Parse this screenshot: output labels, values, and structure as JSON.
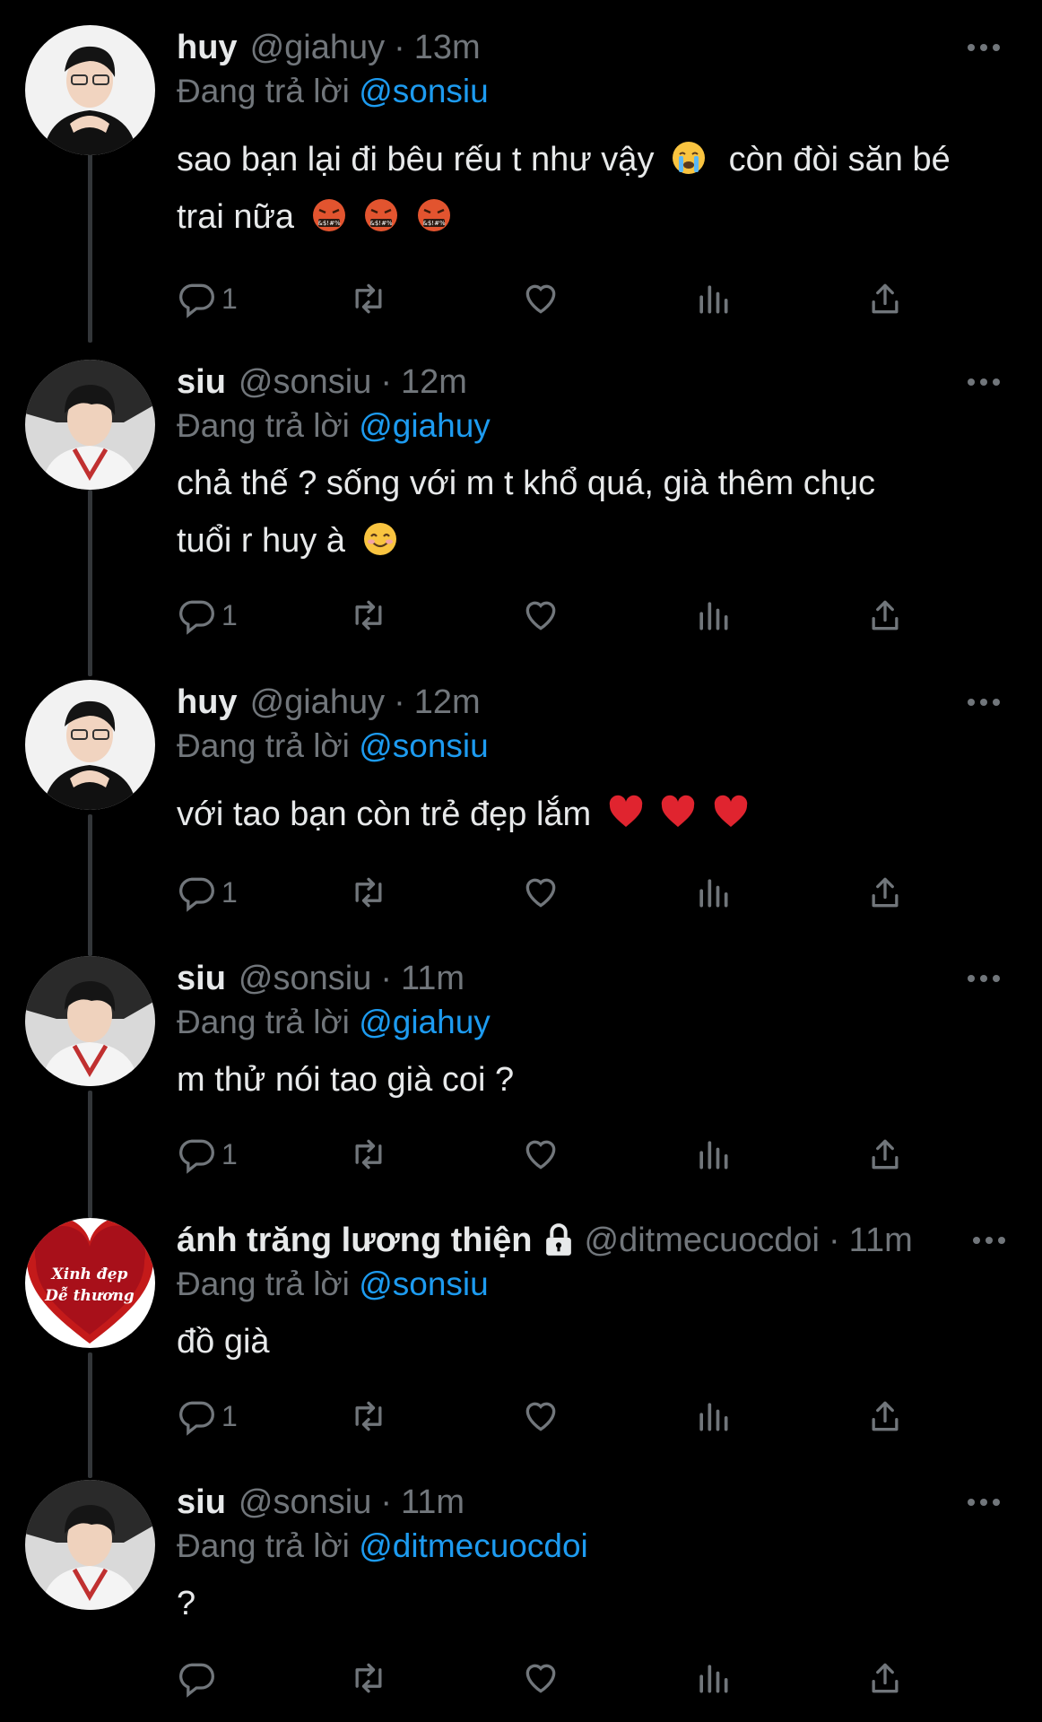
{
  "colors": {
    "background": "#000000",
    "text": "#e7e9ea",
    "muted": "#71767b",
    "mention": "#1d9bf0",
    "thread_line": "#333639"
  },
  "reply_prefix": "Đang trả lời",
  "tweets": [
    {
      "display_name": "huy",
      "handle": "@giahuy",
      "time": "13m",
      "reply_to": "@sonsiu",
      "text": "sao bạn lại đi bêu rếu t như vậy",
      "text2": "còn đòi săn bé",
      "text3": "trai nữa",
      "reply_count": "1",
      "avatar": "avatar-huy"
    },
    {
      "display_name": "siu",
      "handle": "@sonsiu",
      "time": "12m",
      "reply_to": "@giahuy",
      "text": "chả thế ? sống với m t khổ quá, già thêm chục",
      "text2": "tuổi r huy à",
      "reply_count": "1",
      "avatar": "avatar-siu"
    },
    {
      "display_name": "huy",
      "handle": "@giahuy",
      "time": "12m",
      "reply_to": "@sonsiu",
      "text": "với tao bạn còn trẻ đẹp lắm",
      "reply_count": "1",
      "avatar": "avatar-huy"
    },
    {
      "display_name": "siu",
      "handle": "@sonsiu",
      "time": "11m",
      "reply_to": "@giahuy",
      "text": "m thử nói tao già coi ?",
      "reply_count": "1",
      "avatar": "avatar-siu"
    },
    {
      "display_name": "ánh trăng lương thiện",
      "handle": "@ditmecuocdoi",
      "time": "11m",
      "reply_to": "@sonsiu",
      "text": "đồ già",
      "reply_count": "1",
      "avatar": "avatar-heart",
      "avatar_text_1": "Xinh đẹp",
      "avatar_text_2": "Dễ thương",
      "locked": true
    },
    {
      "display_name": "siu",
      "handle": "@sonsiu",
      "time": "11m",
      "reply_to": "@ditmecuocdoi",
      "text": "?",
      "reply_count": "",
      "avatar": "avatar-siu"
    }
  ],
  "icons": {
    "reply": "reply-icon",
    "retweet": "retweet-icon",
    "like": "like-icon",
    "views": "views-icon",
    "share": "share-icon",
    "more": "more-icon",
    "lock": "lock-icon"
  }
}
